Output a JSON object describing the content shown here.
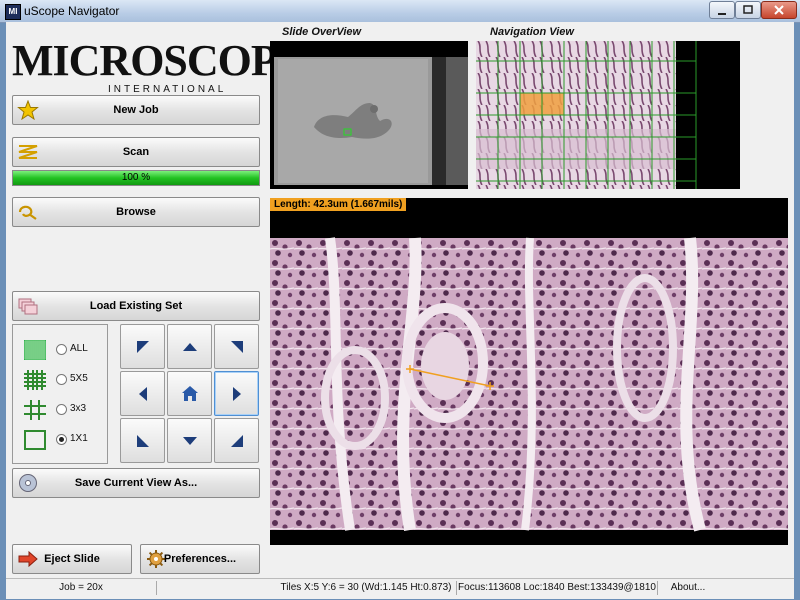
{
  "window": {
    "title": "uScope Navigator",
    "icon_text": "MI"
  },
  "logo": {
    "main": "MICROSCOPES",
    "sub": "INTERNATIONAL"
  },
  "buttons": {
    "new_job": "New Job",
    "scan": "Scan",
    "browse": "Browse",
    "load_existing": "Load Existing Set",
    "save_view": "Save Current View As...",
    "eject": "Eject Slide",
    "preferences": "Preferences..."
  },
  "progress": {
    "value": 100,
    "text": "100 %",
    "color": "#22c222"
  },
  "tile_options": [
    {
      "label": "ALL",
      "selected": false
    },
    {
      "label": "5X5",
      "selected": false
    },
    {
      "label": "3x3",
      "selected": false
    },
    {
      "label": "1X1",
      "selected": true
    }
  ],
  "panels": {
    "overview_title": "Slide OverView",
    "navigation_title": "Navigation View"
  },
  "measurement": {
    "text": "Length: 42.3um (1.667mils)"
  },
  "status": {
    "job": "Job = 20x",
    "tiles": "Tiles X:5 Y:6 = 30 (Wd:1.145 Ht:0.873)",
    "focus": "Focus:113608 Loc:1840 Best:133439@1810",
    "about": "About..."
  },
  "colors": {
    "accent_green": "#2f8a2f",
    "highlight_orange": "#f0a020",
    "nav_arrow": "#1d3d7a"
  }
}
